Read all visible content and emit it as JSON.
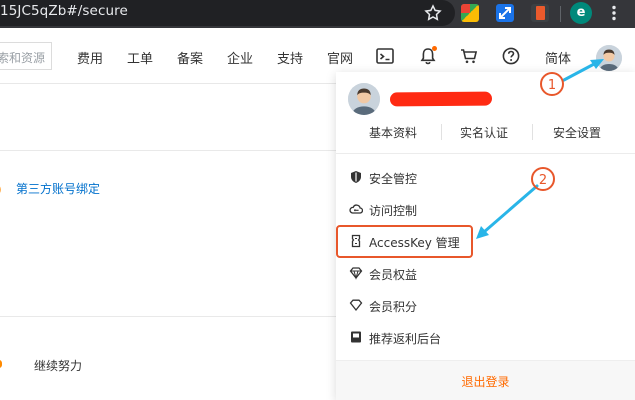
{
  "browser": {
    "url_fragment": "15JC5qZb#/secure",
    "profile_initial": "e",
    "icons": [
      "star-icon",
      "extension-icon",
      "extension-icon",
      "extension-icon",
      "profile-icon",
      "more-vert-icon"
    ]
  },
  "header": {
    "search_placeholder": "索和资源",
    "nav": [
      "费用",
      "工单",
      "备案",
      "企业",
      "支持",
      "官网"
    ],
    "language": "简体",
    "icons": [
      "terminal-icon",
      "bell-icon",
      "cart-icon",
      "help-icon",
      "avatar"
    ]
  },
  "page": {
    "third_party_link": "第三方账号绑定",
    "keep_text": "继续努力",
    "left_fragment": "‌）"
  },
  "dropdown": {
    "tabs": [
      "基本资料",
      "实名认证",
      "安全设置"
    ],
    "menu": [
      {
        "label": "安全管控",
        "icon": "shield-icon"
      },
      {
        "label": "访问控制",
        "icon": "cloud-key-icon"
      },
      {
        "label": "AccessKey 管理",
        "icon": "access-key-icon"
      },
      {
        "label": "会员权益",
        "icon": "diamond-icon"
      },
      {
        "label": "会员积分",
        "icon": "gem-icon"
      },
      {
        "label": "推荐返利后台",
        "icon": "reward-icon"
      }
    ],
    "logout": "退出登录"
  },
  "annotations": {
    "step1": "1",
    "step2": "2",
    "accent": "#e8572b",
    "arrow": "#29b5e8"
  }
}
